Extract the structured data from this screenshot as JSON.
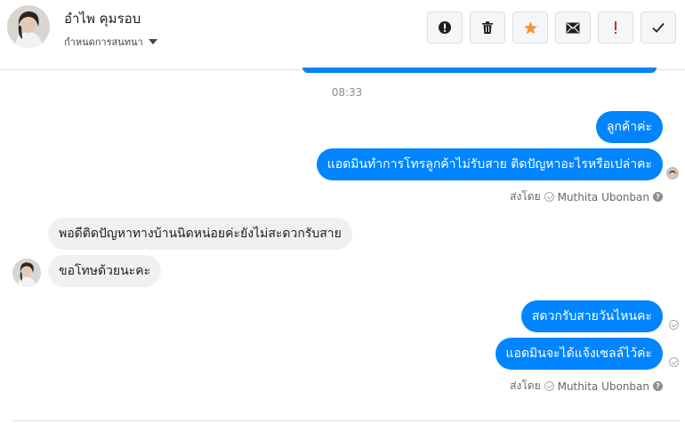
{
  "contact": {
    "name": "อำไพ คุมรอบ",
    "assign_label": "กำหนดการสนทนา"
  },
  "toolbar": [
    {
      "name": "spam-button",
      "icon": "alert-circle-icon"
    },
    {
      "name": "delete-button",
      "icon": "trash-icon"
    },
    {
      "name": "star-button",
      "icon": "star-icon",
      "color": "#f7923b"
    },
    {
      "name": "mark-unread-button",
      "icon": "envelope-icon"
    },
    {
      "name": "important-button",
      "icon": "exclamation-icon",
      "color": "#e0252b"
    },
    {
      "name": "done-button",
      "icon": "check-icon"
    }
  ],
  "conversation": {
    "timestamp": "08:33",
    "messages": [
      {
        "dir": "out",
        "text": "ลูกค้าค่ะ"
      },
      {
        "dir": "out",
        "text": "แอดมินทำการโทรลูกค้าไม่รับสาย ติดปัญหาอะไรหรือเปล่าคะ"
      },
      {
        "dir": "in",
        "text": "พอดีติดปัญหาทางบ้านนิดหน่อยค่ะยังไม่สะดวกรับสาย"
      },
      {
        "dir": "in",
        "text": "ขอโทษด้วยนะคะ"
      },
      {
        "dir": "out",
        "text": "สดวกรับสายวันไหนคะ"
      },
      {
        "dir": "out",
        "text": "แอดมินจะได้แจ้งเซลล์ไว้ค่ะ"
      }
    ],
    "sent_by_prefix": "ส่งโดย",
    "sent_by_name": "Muthita Ubonban",
    "info_glyph": "?"
  },
  "colors": {
    "outgoing_bubble": "#0084ff",
    "incoming_bubble": "#f1f0f0"
  }
}
